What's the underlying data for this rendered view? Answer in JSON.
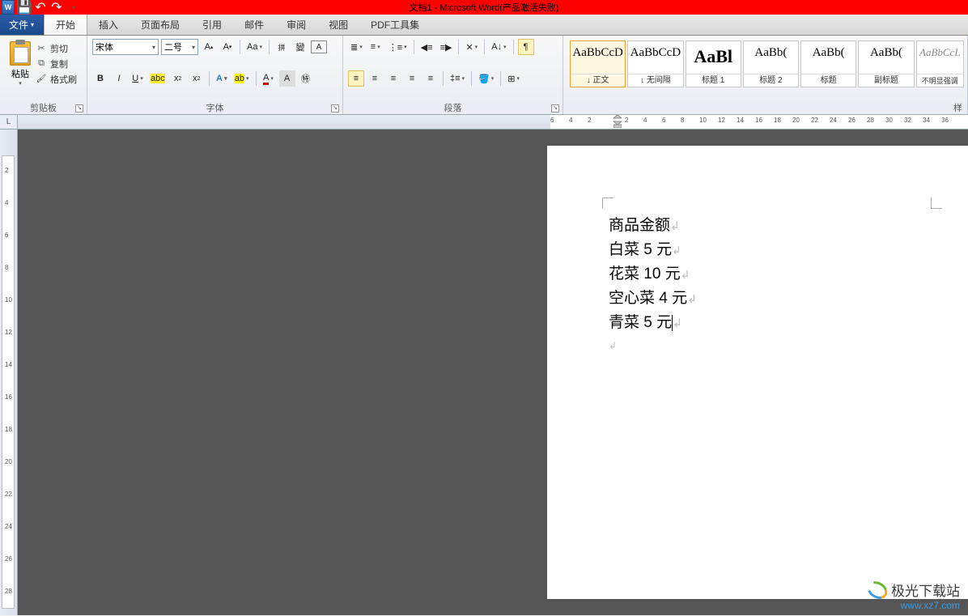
{
  "title": "文档1 - Microsoft Word(产品激活失败)",
  "tabs": {
    "file": "文件",
    "items": [
      "开始",
      "插入",
      "页面布局",
      "引用",
      "邮件",
      "审阅",
      "视图",
      "PDF工具集"
    ],
    "active": "开始"
  },
  "clipboard": {
    "paste": "粘贴",
    "cut": "剪切",
    "copy": "复制",
    "brush": "格式刷",
    "group": "剪贴板"
  },
  "font": {
    "name": "宋体",
    "size": "二号",
    "group": "字体"
  },
  "paragraph": {
    "group": "段落"
  },
  "styles": {
    "preview": "AaBbCcD",
    "preview2": "AaBb(",
    "preview3": "AaBbCcL",
    "items": [
      "↓ 正文",
      "↓ 无间隔",
      "标题 1",
      "标题 2",
      "标题",
      "副标题",
      "不明显强调"
    ],
    "group": "样"
  },
  "ruler": {
    "h": [
      "6",
      "4",
      "2",
      "",
      "2",
      "4",
      "6",
      "8",
      "10",
      "12",
      "14",
      "16",
      "18",
      "20",
      "22",
      "24",
      "26",
      "28",
      "30",
      "32",
      "34",
      "36"
    ]
  },
  "vruler_marks": [
    "2",
    "4",
    "6",
    "8",
    "10",
    "12",
    "14",
    "16",
    "18",
    "20",
    "22",
    "24",
    "26",
    "28"
  ],
  "document": {
    "lines": [
      "商品金额",
      "白菜 5 元",
      "花菜 10 元",
      "空心菜 4 元",
      "青菜 5 元"
    ]
  },
  "watermark": {
    "name": "极光下载站",
    "url": "www.xz7.com"
  }
}
